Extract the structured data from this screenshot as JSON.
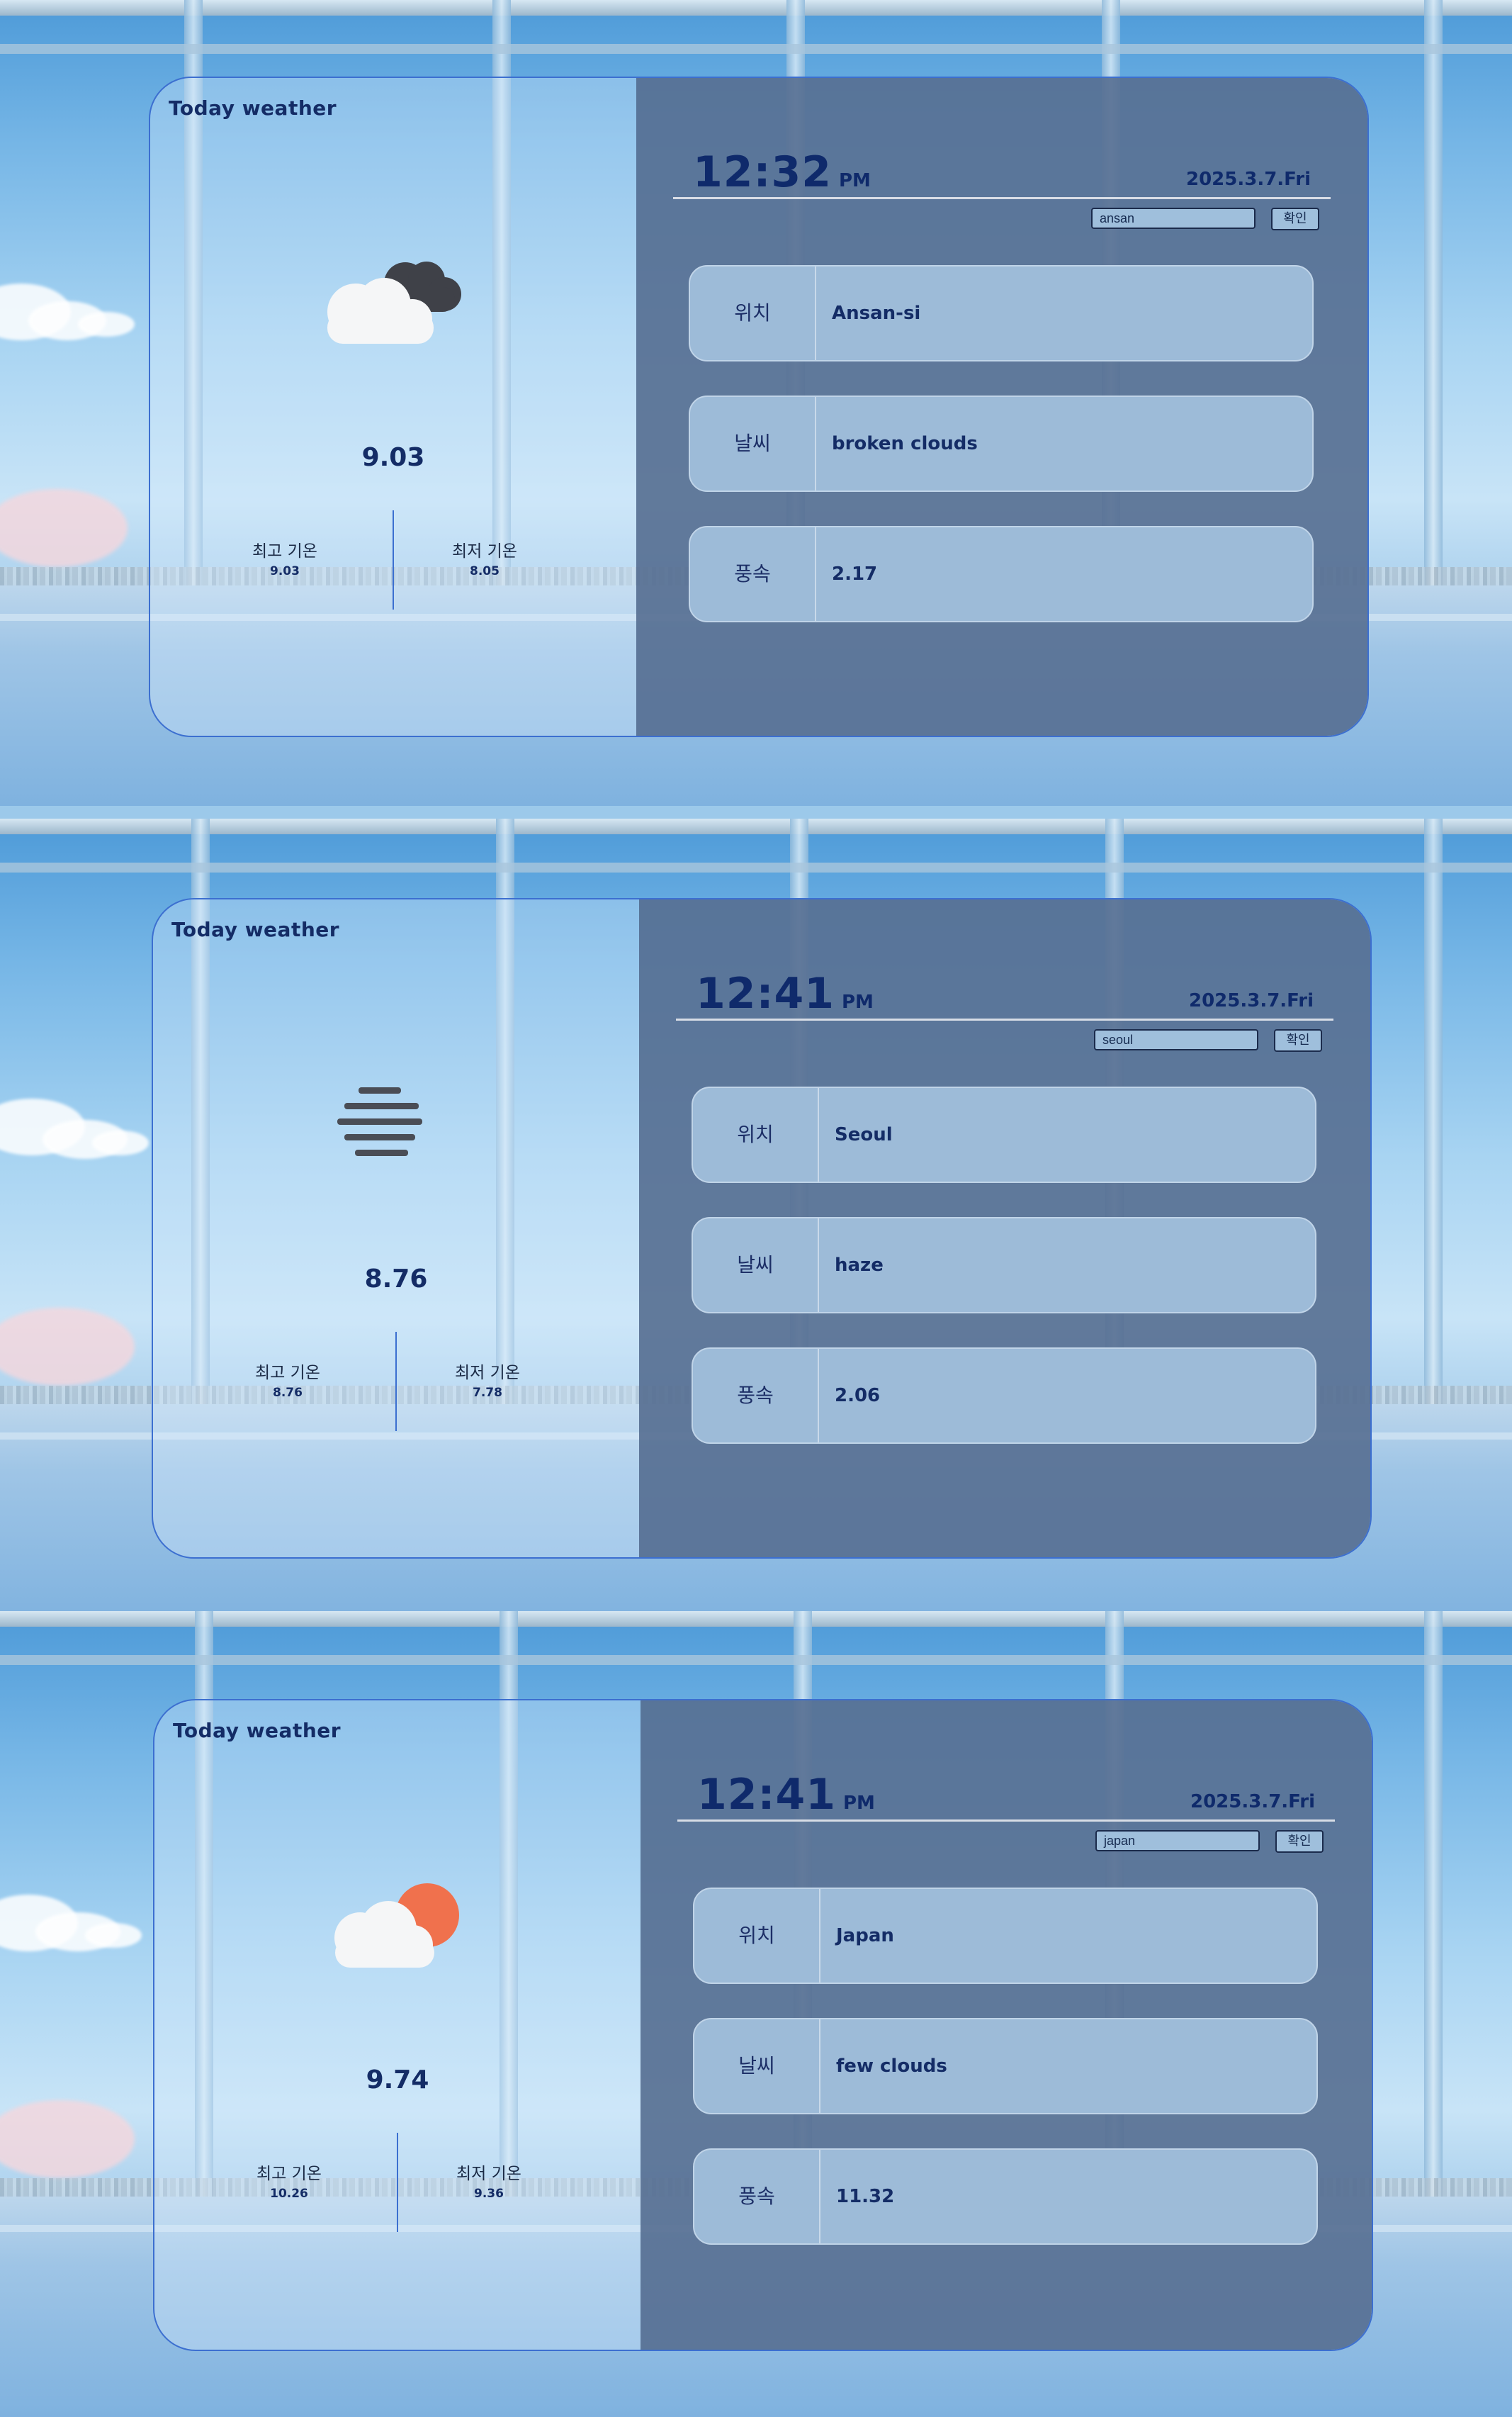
{
  "screens": [
    {
      "title": "Today weather",
      "icon": "broken-clouds-icon",
      "temp": "9.03",
      "max_label": "최고 기온",
      "max_value": "9.03",
      "min_label": "최저 기온",
      "min_value": "8.05",
      "time": "12:32",
      "ampm": "PM",
      "date": "2025.3.7.Fri",
      "search_value": "ansan",
      "confirm_label": "확인",
      "location_label": "위치",
      "location_value": "Ansan-si",
      "weather_label": "날씨",
      "weather_value": "broken clouds",
      "wind_label": "풍속",
      "wind_value": "2.17"
    },
    {
      "title": "Today weather",
      "icon": "haze-icon",
      "temp": "8.76",
      "max_label": "최고 기온",
      "max_value": "8.76",
      "min_label": "최저 기온",
      "min_value": "7.78",
      "time": "12:41",
      "ampm": "PM",
      "date": "2025.3.7.Fri",
      "search_value": "seoul",
      "confirm_label": "확인",
      "location_label": "위치",
      "location_value": "Seoul",
      "weather_label": "날씨",
      "weather_value": "haze",
      "wind_label": "풍속",
      "wind_value": "2.06"
    },
    {
      "title": "Today weather",
      "icon": "few-clouds-icon",
      "temp": "9.74",
      "max_label": "최고 기온",
      "max_value": "10.26",
      "min_label": "최저 기온",
      "min_value": "9.36",
      "time": "12:41",
      "ampm": "PM",
      "date": "2025.3.7.Fri",
      "search_value": "japan",
      "confirm_label": "확인",
      "location_label": "위치",
      "location_value": "Japan",
      "weather_label": "날씨",
      "weather_value": "few clouds",
      "wind_label": "풍속",
      "wind_value": "11.32"
    }
  ],
  "colors": {
    "accent": "#3c6fd0",
    "text_dark": "#142c66",
    "right_panel": "#4f688c",
    "row_bg": "#9dbbd8",
    "sun": "#f0714d",
    "dark_cloud": "#3f4148"
  }
}
